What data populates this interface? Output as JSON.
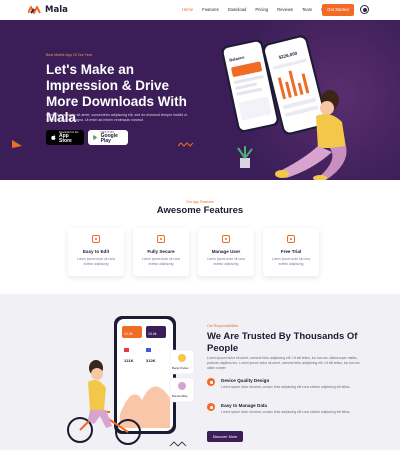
{
  "nav": {
    "logo": "Mala",
    "links": [
      "Home",
      "Features",
      "Download",
      "Pricing",
      "Reviews",
      "Team",
      "Blog"
    ],
    "cta": "Get Started"
  },
  "hero": {
    "kicker": "Best Mobile App Of Our Year",
    "title": "Let's Make an Impression & Drive More Downloads With Mala",
    "description": "Lorem ipsum dolor sit amet, consectetur adipiscing elit, sed do eiusmod tempor incidid ut labore et dolore magna. Ut enim ad minim venimquis nostrud",
    "appstore": {
      "small": "Download on the",
      "big": "App Store"
    },
    "googleplay": {
      "small": "GET IT ON",
      "big": "Google Play"
    },
    "phone_back": {
      "title": "Balance",
      "amount": "$24,000"
    },
    "phone_front": {
      "amount": "$226,000"
    }
  },
  "features": {
    "kicker": "Our App Features",
    "title": "Awesome Features",
    "cards": [
      {
        "title": "Easy to Edit",
        "desc": "Lorem ipsum dolor sit cons ectetur adipiscing"
      },
      {
        "title": "Fully Secure",
        "desc": "Lorem ipsum dolor sit cons ectetur adipiscing"
      },
      {
        "title": "Manage User",
        "desc": "Lorem ipsum dolor sit cons ectetur adipiscing"
      },
      {
        "title": "Free Trial",
        "desc": "Lorem ipsum dolor sit cons ectetur adipiscing"
      }
    ]
  },
  "trust": {
    "kicker": "Our Responsibilities",
    "title": "We Are Trusted By Thousands Of People",
    "description": "Lorem ipsum dolor sit amet, consect tetur adipiscing elit. Ut elit tellus, luc tus nec ullamcorper mattis, pulvinar dapibus leo. Lorem ipsum dolor sit amet, consect tetur adipiscing elit. Ut elit tellus, luc tus nec ullam corper.",
    "items": [
      {
        "title": "Device Quality Design",
        "desc": "Lorem ipsum dolor sit amet, consec tetur adipiscing elit cons ectetur adipiscing elit tellus."
      },
      {
        "title": "Easy to Manage Data",
        "desc": "Lorem ipsum dolor sit amet, consec tetur adipiscing elit cons ectetur adipiscing elit tellus."
      }
    ],
    "cta": "Discover More",
    "phone": {
      "stat1": "12.2k",
      "stat2": "10.0k",
      "row1": "121K",
      "row2": "312K"
    },
    "profiles": [
      "Becky Parker",
      "Bonnie Riley"
    ]
  },
  "colors": {
    "accent": "#f06b25",
    "hero_bg": "#3b1e58",
    "section_bg": "#f1f0f4"
  }
}
